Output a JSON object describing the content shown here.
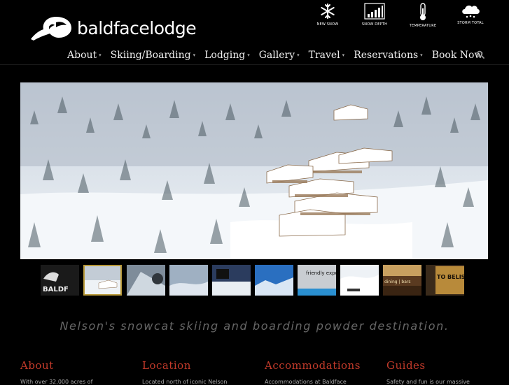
{
  "brand": {
    "logo_text": "baldfacelodge"
  },
  "conditions": [
    {
      "icon": "snowflake-icon",
      "label": "NEW SNOW"
    },
    {
      "icon": "snow-depth-bars-icon",
      "label": "SNOW DEPTH"
    },
    {
      "icon": "thermometer-icon",
      "label": "TEMPERATURE"
    },
    {
      "icon": "cloud-snow-icon",
      "label": "STORM TOTAL"
    }
  ],
  "nav": {
    "items": [
      {
        "label": "About",
        "dropdown": true
      },
      {
        "label": "Skiing/Boarding",
        "dropdown": true
      },
      {
        "label": "Lodging",
        "dropdown": true
      },
      {
        "label": "Gallery",
        "dropdown": true
      },
      {
        "label": "Travel",
        "dropdown": true
      },
      {
        "label": "Reservations",
        "dropdown": true
      },
      {
        "label": "Book Now",
        "dropdown": false
      }
    ],
    "caret": "▾",
    "search_icon": "search-icon"
  },
  "thumbnails": {
    "active_index": 1,
    "items": [
      {
        "text": "BALDF"
      },
      {
        "text": ""
      },
      {
        "text": ""
      },
      {
        "text": ""
      },
      {
        "text": ""
      },
      {
        "text": ""
      },
      {
        "text": "friendly experience certified."
      },
      {
        "text": ""
      },
      {
        "text": "dining | bars"
      },
      {
        "text": "TO BELIS RID"
      }
    ]
  },
  "tagline": "Nelson's snowcat skiing and boarding powder destination.",
  "sections": [
    {
      "title": "About",
      "text": "With over 32,000 acres of"
    },
    {
      "title": "Location",
      "text": "Located north of iconic Nelson"
    },
    {
      "title": "Accommodations",
      "text": "Accommodations at Baldface"
    },
    {
      "title": "Guides",
      "text": "Safety and fun is our massive"
    }
  ],
  "colors": {
    "accent": "#c23a2a",
    "thumb_active": "#b99a3a",
    "background": "#000000"
  }
}
